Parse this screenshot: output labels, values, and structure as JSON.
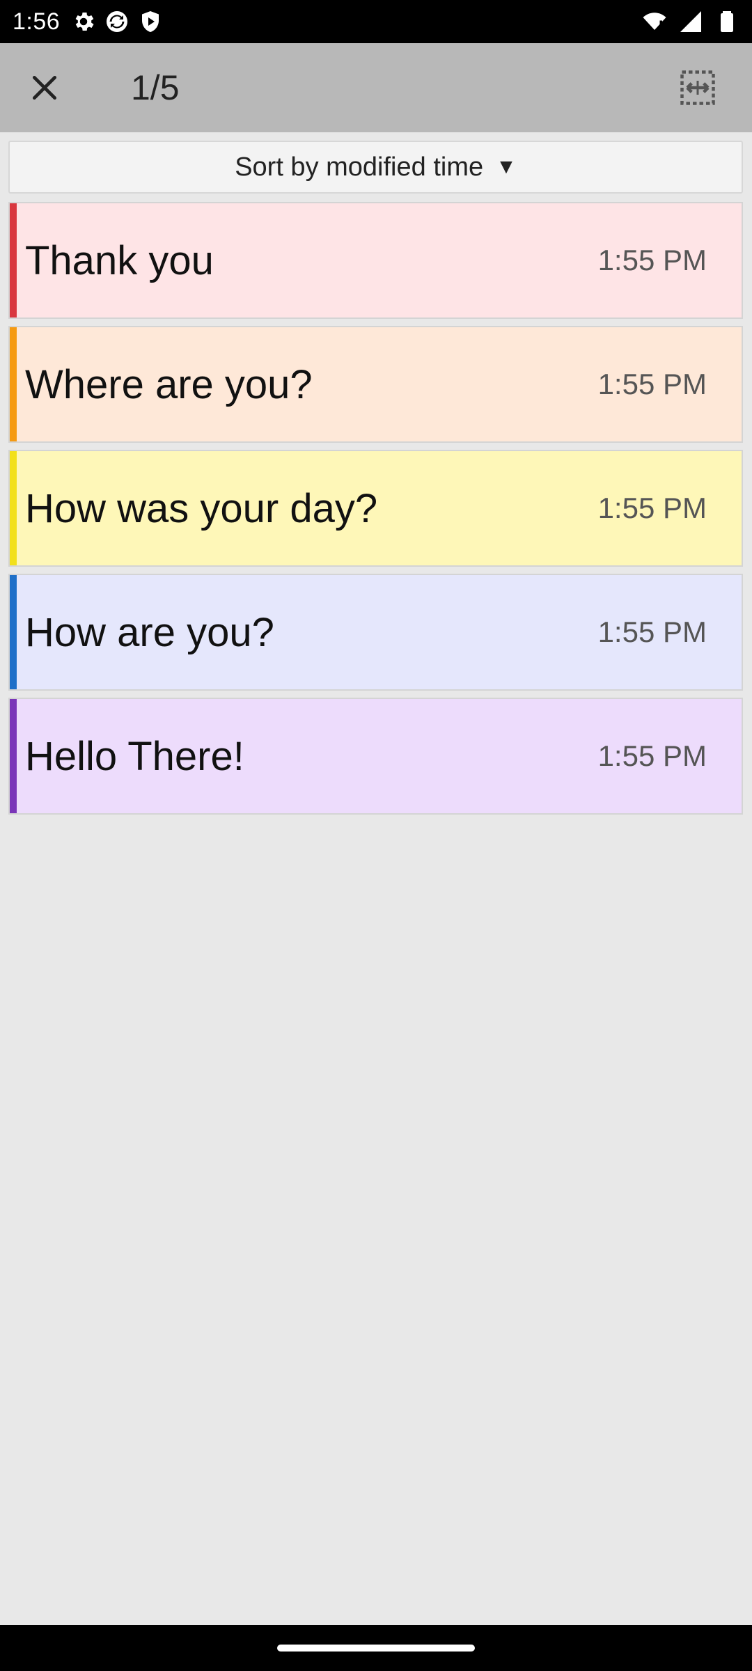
{
  "status_bar": {
    "time": "1:56",
    "icons": [
      "settings-gear-icon",
      "sync-icon",
      "shield-icon",
      "wifi-icon",
      "signal-icon",
      "battery-icon"
    ]
  },
  "app_bar": {
    "counter": "1/5",
    "close_icon": "close-icon",
    "select_icon": "select-all-icon"
  },
  "sort": {
    "label": "Sort by modified time",
    "arrow": "▼"
  },
  "notes": [
    {
      "title": "Thank you",
      "time": "1:55 PM",
      "bg": "#fee4e6",
      "stripe": "#d9373f"
    },
    {
      "title": "Where are you?",
      "time": "1:55 PM",
      "bg": "#fee8d8",
      "stripe": "#f59a12"
    },
    {
      "title": "How was your day?",
      "time": "1:55 PM",
      "bg": "#fef7b8",
      "stripe": "#f2e01a"
    },
    {
      "title": "How are you?",
      "time": "1:55 PM",
      "bg": "#e5e7fc",
      "stripe": "#1f6fc8"
    },
    {
      "title": "Hello There!",
      "time": "1:55 PM",
      "bg": "#eddcfc",
      "stripe": "#7a35b8"
    }
  ]
}
